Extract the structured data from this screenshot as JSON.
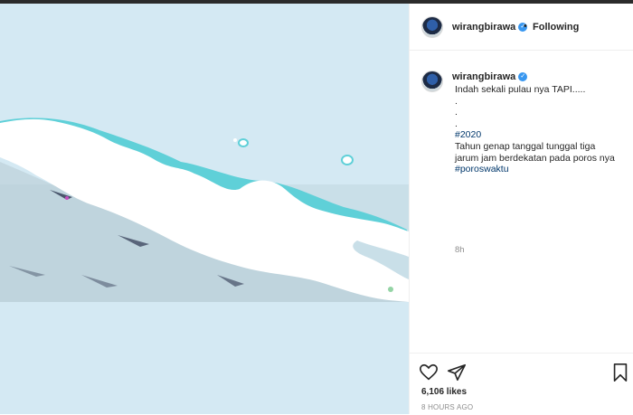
{
  "post": {
    "username": "wirangbirawa",
    "follow_status": "Following",
    "separator": "•",
    "caption_text": "Indah sekali pulau nya TAPI.....\n.\n.\n.",
    "hashtag_year": "#2020",
    "caption_text2": "Tahun genap tanggal tunggal tiga jarum jam berdekatan pada poros nya ",
    "hashtag_poros": "#poroswaktu",
    "comment_time": "8h",
    "likes": "6,106 likes",
    "posted_ago": "8 HOURS AGO"
  },
  "icons": {
    "verified": "verified-badge-icon",
    "like": "heart-icon",
    "share": "paper-plane-icon",
    "save": "bookmark-icon"
  },
  "colors": {
    "sea": "#d4e9f3",
    "island": "#ffffff",
    "shallow": "#5fd0d8",
    "link": "#00376b",
    "verified": "#3897f0"
  }
}
